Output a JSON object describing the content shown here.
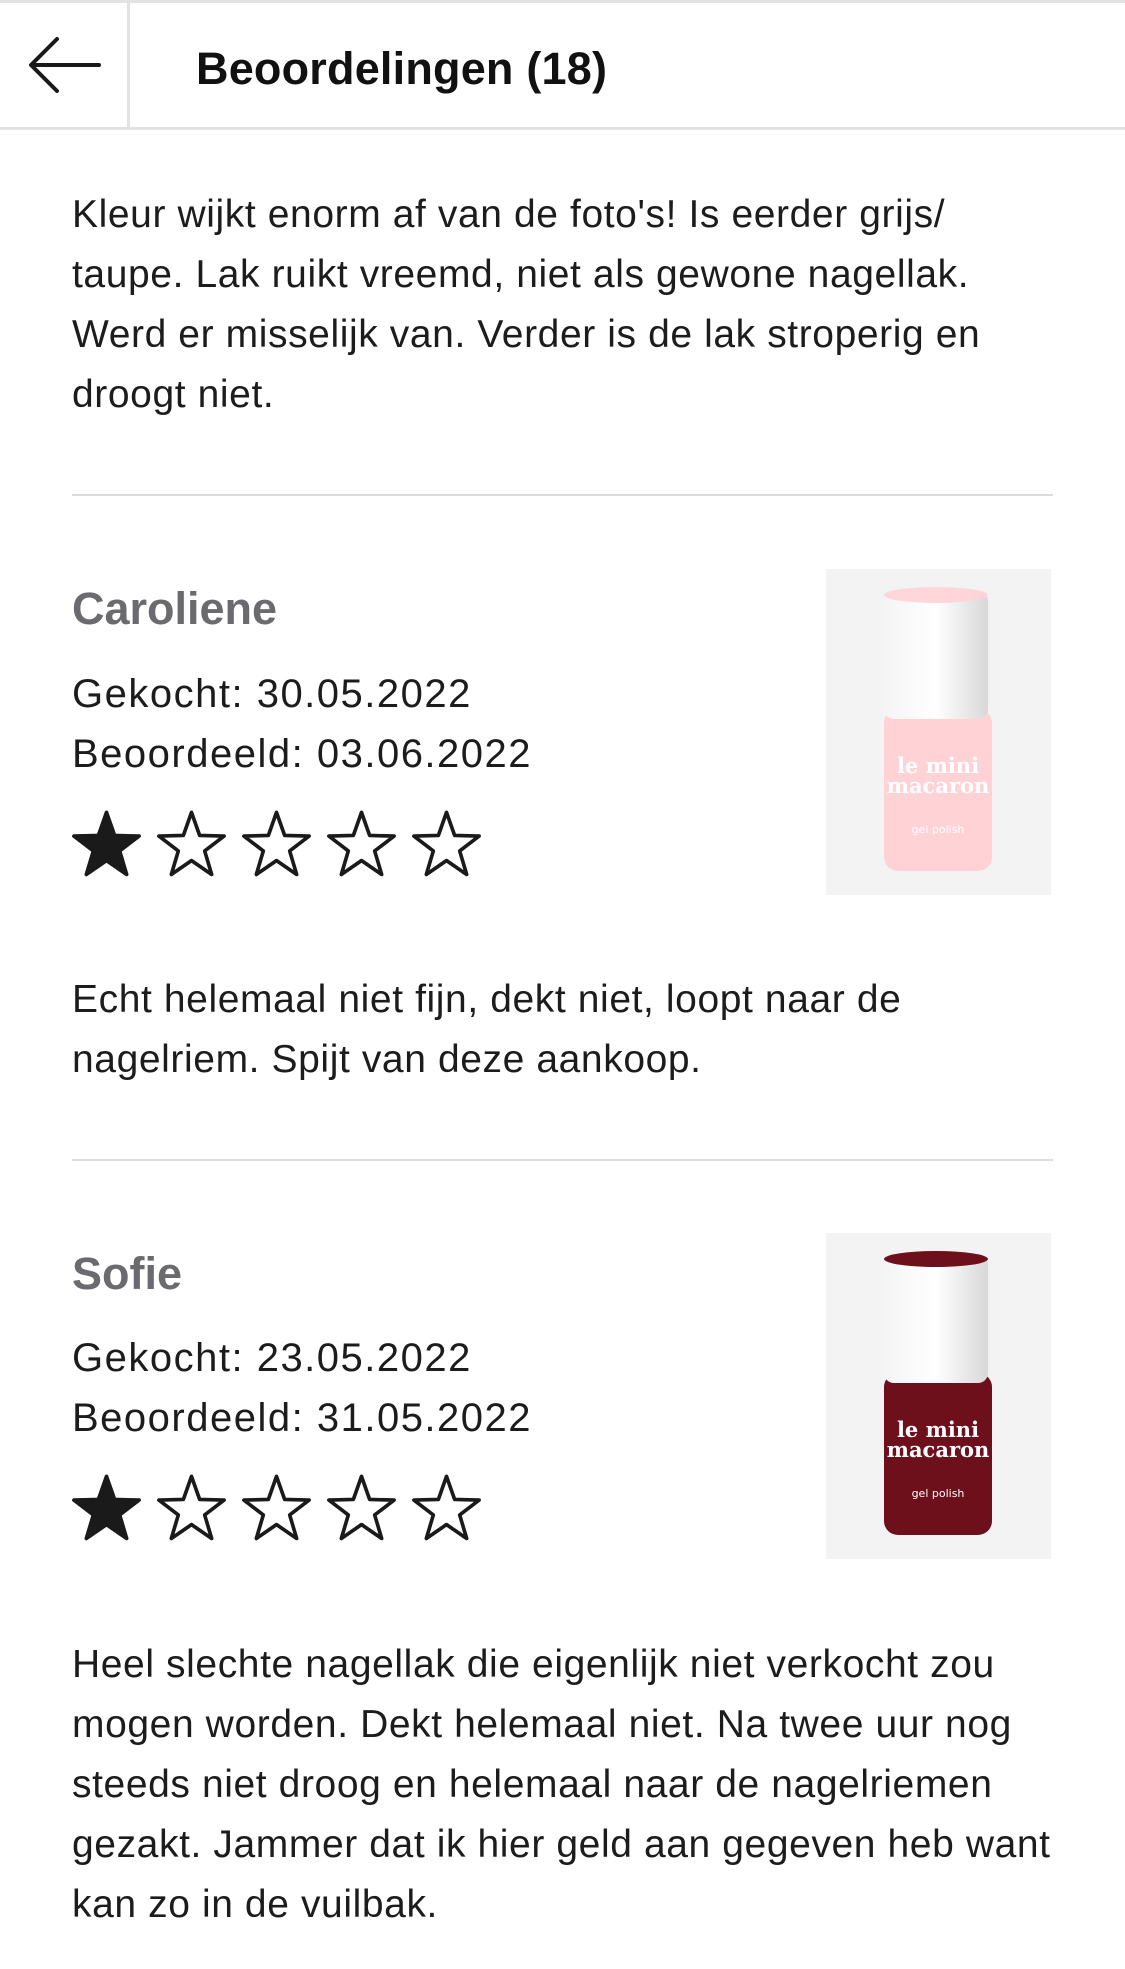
{
  "header": {
    "back_icon": "arrow-left-icon",
    "title": "Beoordelingen (18)"
  },
  "previous_review": {
    "text": "Kleur wijkt enorm af van de foto's! Is eerder grijs/ taupe. Lak ruikt vreemd, niet als gewone nagellak. Werd er misselijk van. Verder is de lak stroperig en droogt niet."
  },
  "reviews": [
    {
      "name": "Caroliene",
      "purchased": "Gekocht: 30.05.2022",
      "reviewed": "Beoordeeld: 03.06.2022",
      "rating": 1,
      "rating_max": 5,
      "product": {
        "brand_line1": "le mini",
        "brand_line2": "macaron",
        "sub": "gel polish",
        "bottle_color": "#ffd3d6",
        "cap_color": "#e8e8e8"
      },
      "text": "Echt helemaal niet fijn, dekt niet, loopt naar de nagelriem. Spijt van deze aankoop."
    },
    {
      "name": "Sofie",
      "purchased": "Gekocht: 23.05.2022",
      "reviewed": "Beoordeeld: 31.05.2022",
      "rating": 1,
      "rating_max": 5,
      "product": {
        "brand_line1": "le mini",
        "brand_line2": "macaron",
        "sub": "gel polish",
        "bottle_color": "#6e0f1c",
        "cap_color": "#e8e8e8"
      },
      "text": "Heel slechte nagellak die eigenlijk niet verkocht zou mogen worden. Dekt helemaal niet. Na twee uur nog steeds niet droog en helemaal naar de nagelriemen gezakt. Jammer dat ik hier geld aan gegeven heb want kan zo in de vuilbak."
    }
  ],
  "colors": {
    "star_filled": "#1a1a1a",
    "name_gray": "#6b6b6f",
    "divider": "#dcdcdc"
  }
}
